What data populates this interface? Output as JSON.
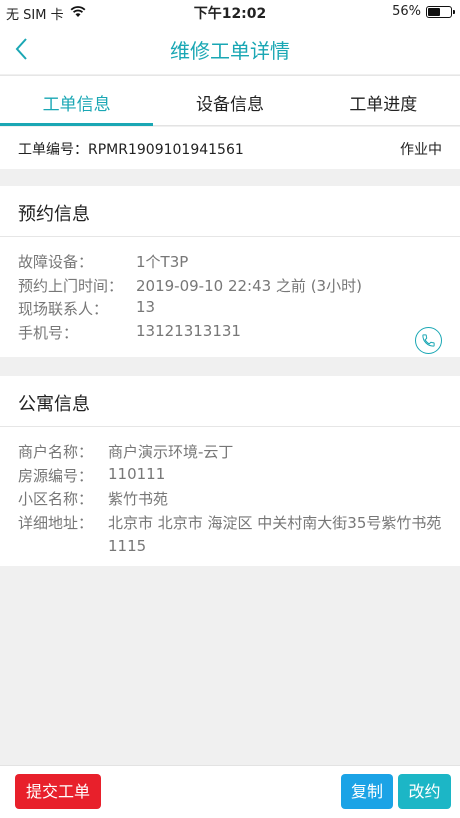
{
  "status_bar": {
    "carrier": "无 SIM 卡",
    "time": "下午12:02",
    "battery_percent_label": "56%",
    "battery_level": 0.56
  },
  "nav": {
    "title": "维修工单详情",
    "back_icon": "chevron-left-icon"
  },
  "tabs": [
    {
      "label": "工单信息",
      "active": true
    },
    {
      "label": "设备信息",
      "active": false
    },
    {
      "label": "工单进度",
      "active": false
    }
  ],
  "order": {
    "label": "工单编号：RPMR1909101941561",
    "status": "作业中"
  },
  "appointment": {
    "title": "预约信息",
    "rows": [
      {
        "key": "故障设备：",
        "value": "1个T3P"
      },
      {
        "key": "预约上门时间：",
        "value": "2019-09-10 22:43 之前 (3小时)"
      },
      {
        "key": "现场联系人：",
        "value": "13"
      },
      {
        "key": "手机号：",
        "value": "13121313131"
      }
    ],
    "phone_icon": "phone-icon"
  },
  "apartment": {
    "title": "公寓信息",
    "rows": [
      {
        "key": "商户名称：",
        "value": "商户演示环境-云丁"
      },
      {
        "key": "房源编号：",
        "value": "110111"
      },
      {
        "key": "小区名称：",
        "value": "紫竹书苑"
      },
      {
        "key": "详细地址：",
        "value": "北京市 北京市 海淀区 中关村南大街35号紫竹书苑1115"
      }
    ]
  },
  "actions": {
    "submit": "提交工单",
    "copy": "复制",
    "change": "改约"
  },
  "colors": {
    "accent": "#1aa7b4",
    "submit": "#e8202b",
    "copy": "#1ba3e6",
    "change": "#1cb6c6"
  }
}
